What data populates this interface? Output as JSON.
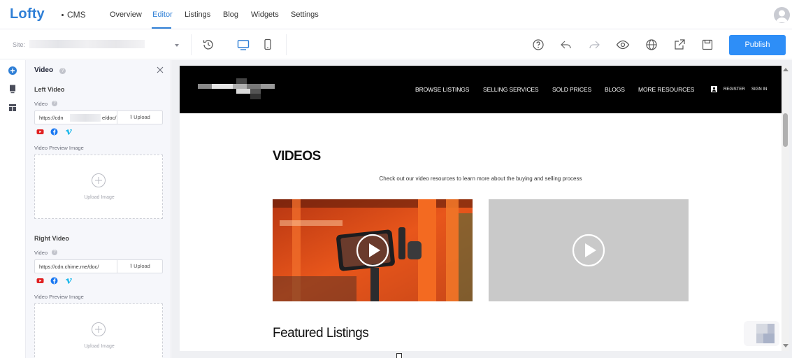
{
  "app": {
    "logo": "Lofty",
    "module": "CMS",
    "tabs": [
      {
        "label": "Overview",
        "active": false
      },
      {
        "label": "Editor",
        "active": true
      },
      {
        "label": "Listings",
        "active": false
      },
      {
        "label": "Blog",
        "active": false
      },
      {
        "label": "Widgets",
        "active": false
      },
      {
        "label": "Settings",
        "active": false
      }
    ],
    "accent_color": "#2f7fd6"
  },
  "toolbar": {
    "site_label": "Site:",
    "icons": [
      "history-icon",
      "desktop-icon",
      "mobile-icon",
      "help-icon",
      "undo-icon",
      "redo-icon",
      "preview-icon",
      "globe-icon",
      "share-icon",
      "save-icon"
    ],
    "publish_label": "Publish",
    "publish_color": "#2e8ef7"
  },
  "panel": {
    "title": "Video",
    "left_video": {
      "section": "Left Video",
      "video_label": "Video",
      "url_start": "https://cdn",
      "url_end": "e/doc/",
      "upload_label": "Upload",
      "preview_label": "Video Preview Image",
      "upload_image_label": "Upload Image"
    },
    "right_video": {
      "section": "Right Video",
      "video_label": "Video",
      "url": "https://cdn.chime.me/doc/",
      "upload_label": "Upload",
      "preview_label": "Video Preview Image",
      "upload_image_label": "Upload Image"
    },
    "social_icons": [
      "youtube-icon",
      "facebook-icon",
      "vimeo-icon"
    ]
  },
  "site": {
    "nav": [
      "BROWSE LISTINGS",
      "SELLING SERVICES",
      "SOLD PRICES",
      "BLOGS",
      "MORE RESOURCES"
    ],
    "register": "REGISTER",
    "sign_in": "SIGN IN",
    "videos_heading": "VIDEOS",
    "videos_sub": "Check out our video resources to learn more about the buying and selling process",
    "featured_heading": "Featured Listings"
  }
}
